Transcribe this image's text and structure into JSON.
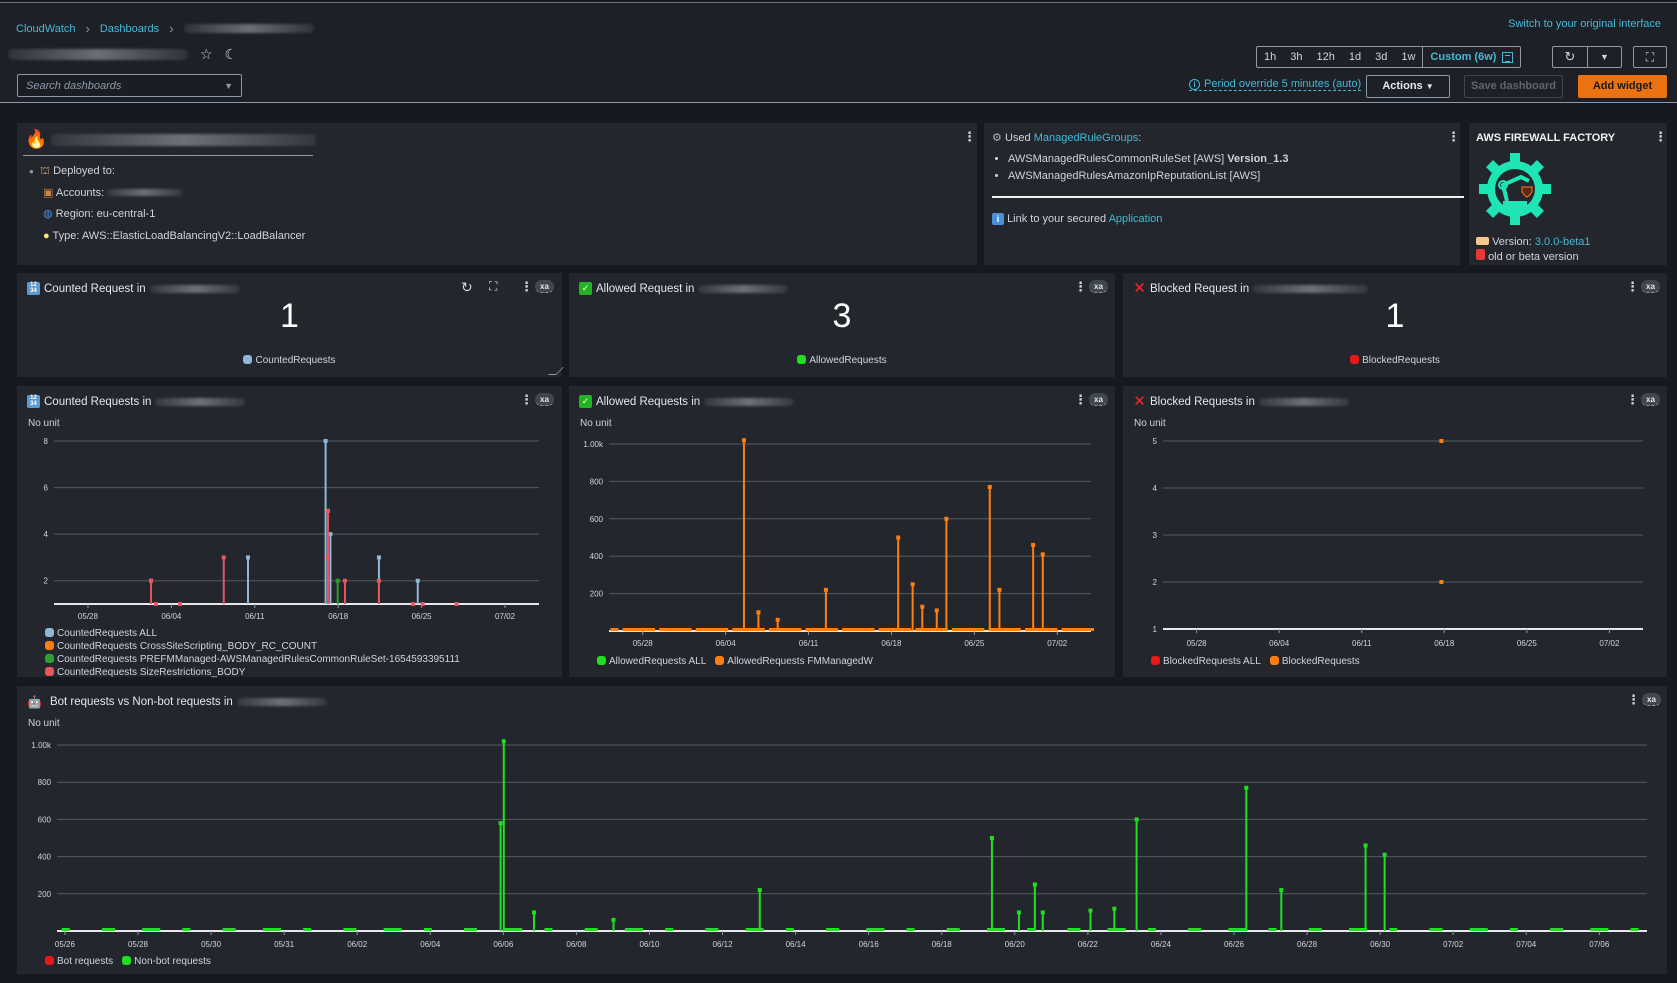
{
  "header": {
    "breadcrumb": [
      "CloudWatch",
      "Dashboards"
    ],
    "switch_link": "Switch to your original interface",
    "search_placeholder": "Search dashboards",
    "time_ranges": [
      "1h",
      "3h",
      "12h",
      "1d",
      "3d",
      "1w"
    ],
    "custom_range": "Custom (6w)",
    "period_override": "Period override 5 minutes (auto)",
    "actions_label": "Actions",
    "save_label": "Save dashboard",
    "add_widget_label": "Add widget"
  },
  "info_widget": {
    "deployed_to": "Deployed to:",
    "accounts": "Accounts:",
    "region": "Region: eu-central-1",
    "type": "Type: AWS::ElasticLoadBalancingV2::LoadBalancer"
  },
  "rules_widget": {
    "used_prefix": "Used",
    "managed_link": "ManagedRuleGroups",
    "colon": ":",
    "rules": [
      {
        "name": "AWSManagedRulesCommonRuleSet [AWS]",
        "version": "Version_1.3"
      },
      {
        "name": "AWSManagedRulesAmazonIpReputationList [AWS]",
        "version": ""
      }
    ],
    "link_prefix": "Link to your secured",
    "app_link": "Application"
  },
  "factory_widget": {
    "title": "AWS FIREWALL FACTORY",
    "version_label": "Version:",
    "version_value": "3.0.0-beta1",
    "warning": "old or beta version"
  },
  "single_values": [
    {
      "title": "Counted Request in",
      "value": "1",
      "legend": "CountedRequests",
      "color": "#8fb8d8"
    },
    {
      "title": "Allowed Request in",
      "value": "3",
      "legend": "AllowedRequests",
      "color": "#1ee01e"
    },
    {
      "title": "Blocked Request in",
      "value": "1",
      "legend": "BlockedRequests",
      "color": "#e81818"
    }
  ],
  "badge": "xa",
  "no_unit": "No unit",
  "chart_data": [
    {
      "type": "line",
      "title": "Counted Requests in",
      "ylabel": "No unit",
      "ylim": [
        1,
        8
      ],
      "yticks": [
        "2",
        "4",
        "6",
        "8"
      ],
      "xticks": [
        "05/28",
        "06/04",
        "06/11",
        "06/18",
        "06/25",
        "07/02"
      ],
      "legend_position": "bottom",
      "series": [
        {
          "name": "CountedRequests ALL",
          "color": "#8fb8d8",
          "spikes": [
            [
              0.2,
              2
            ],
            [
              0.4,
              3
            ],
            [
              0.56,
              8
            ],
            [
              0.57,
              4
            ],
            [
              0.67,
              3
            ],
            [
              0.75,
              2
            ]
          ]
        },
        {
          "name": "CountedRequests CrossSiteScripting_BODY_RC_COUNT",
          "color": "#ff7f0e",
          "spikes": []
        },
        {
          "name": "CountedRequests PREFMManaged-AWSManagedRulesCommonRuleSet-1654593395111",
          "color": "#2ca02c",
          "spikes": [
            [
              0.565,
              5
            ],
            [
              0.585,
              2
            ],
            [
              0.67,
              2
            ]
          ]
        },
        {
          "name": "CountedRequests SizeRestrictions_BODY",
          "color": "#e8555e",
          "spikes": [
            [
              0.2,
              2
            ],
            [
              0.21,
              1
            ],
            [
              0.26,
              1
            ],
            [
              0.35,
              3
            ],
            [
              0.565,
              5
            ],
            [
              0.565,
              3
            ],
            [
              0.6,
              2
            ],
            [
              0.67,
              2
            ],
            [
              0.74,
              1
            ],
            [
              0.76,
              1
            ],
            [
              0.83,
              1
            ]
          ]
        }
      ]
    },
    {
      "type": "line",
      "title": "Allowed Requests in",
      "ylabel": "No unit",
      "ylim": [
        0,
        1000
      ],
      "yticks": [
        "200",
        "400",
        "600",
        "800",
        "1.00k"
      ],
      "xticks": [
        "05/28",
        "06/04",
        "06/11",
        "06/18",
        "06/25",
        "07/02"
      ],
      "legend_position": "bottom",
      "series": [
        {
          "name": "AllowedRequests ALL",
          "color": "#1ee01e",
          "spikes": []
        },
        {
          "name": "AllowedRequests FMManagedW",
          "color": "#ff7f0e",
          "spikes": [
            [
              0.28,
              1020
            ],
            [
              0.31,
              100
            ],
            [
              0.35,
              60
            ],
            [
              0.45,
              220
            ],
            [
              0.6,
              500
            ],
            [
              0.63,
              250
            ],
            [
              0.65,
              130
            ],
            [
              0.68,
              110
            ],
            [
              0.7,
              600
            ],
            [
              0.79,
              770
            ],
            [
              0.81,
              220
            ],
            [
              0.88,
              460
            ],
            [
              0.9,
              410
            ]
          ]
        }
      ]
    },
    {
      "type": "scatter",
      "title": "Blocked Requests in",
      "ylabel": "No unit",
      "ylim": [
        1,
        5
      ],
      "yticks": [
        "1",
        "2",
        "3",
        "4",
        "5"
      ],
      "xticks": [
        "05/28",
        "06/04",
        "06/11",
        "06/18",
        "06/25",
        "07/02"
      ],
      "legend_position": "bottom",
      "series": [
        {
          "name": "BlockedRequests ALL",
          "color": "#e81818",
          "points": []
        },
        {
          "name": "BlockedRequests",
          "color": "#ff7f0e",
          "points": [
            [
              0.58,
              5
            ],
            [
              0.58,
              2
            ]
          ]
        }
      ]
    },
    {
      "type": "line",
      "title": "Bot requests vs Non-bot requests in",
      "ylabel": "No unit",
      "ylim": [
        0,
        1000
      ],
      "yticks": [
        "200",
        "400",
        "600",
        "800",
        "1.00k"
      ],
      "xticks": [
        "05/26",
        "05/28",
        "05/30",
        "05/31",
        "06/02",
        "06/04",
        "06/06",
        "06/08",
        "06/10",
        "06/12",
        "06/14",
        "06/16",
        "06/18",
        "06/20",
        "06/22",
        "06/24",
        "06/26",
        "06/28",
        "06/30",
        "07/02",
        "07/04",
        "07/06"
      ],
      "legend_position": "bottom-left",
      "series": [
        {
          "name": "Bot requests",
          "color": "#e81818",
          "spikes": []
        },
        {
          "name": "Non-bot requests",
          "color": "#1ee01e",
          "spikes": [
            [
              0.281,
              1020
            ],
            [
              0.279,
              580
            ],
            [
              0.3,
              100
            ],
            [
              0.35,
              60
            ],
            [
              0.442,
              220
            ],
            [
              0.588,
              500
            ],
            [
              0.605,
              100
            ],
            [
              0.615,
              250
            ],
            [
              0.62,
              100
            ],
            [
              0.65,
              110
            ],
            [
              0.665,
              120
            ],
            [
              0.679,
              600
            ],
            [
              0.748,
              770
            ],
            [
              0.77,
              220
            ],
            [
              0.823,
              460
            ],
            [
              0.835,
              410
            ]
          ]
        }
      ]
    }
  ]
}
